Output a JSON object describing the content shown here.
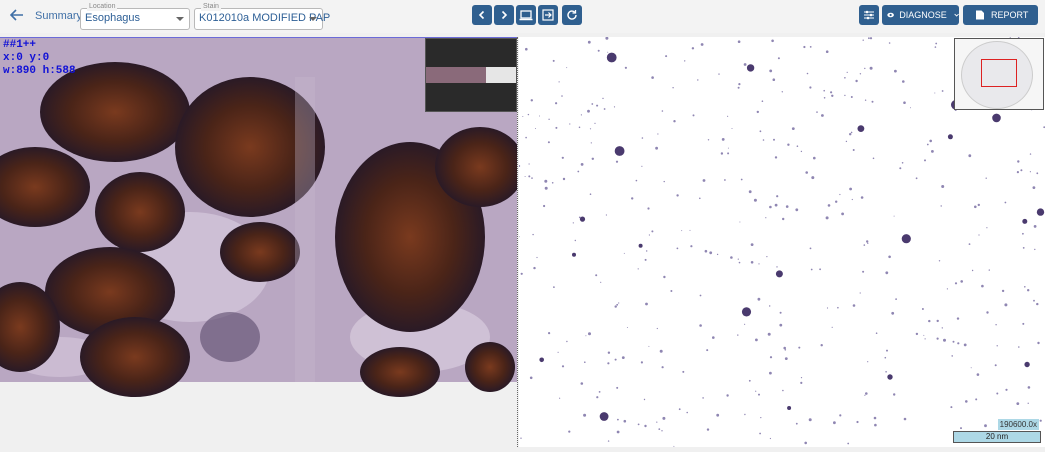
{
  "toolbar": {
    "back_icon": "arrow-left-icon",
    "summary_label": "Summary",
    "location": {
      "label": "Location",
      "value": "Esophagus"
    },
    "stain": {
      "label": "Stain",
      "value": "K012010a MODIFIED PAP"
    },
    "nav_buttons": [
      "chevron-left-icon",
      "chevron-right-icon",
      "laptop-icon",
      "exit-icon",
      "refresh-icon"
    ],
    "settings_icon": "sliders-icon",
    "diagnose_label": "DIAGNOSE",
    "report_label": "REPORT"
  },
  "left_viewer": {
    "overlay_line1": "##1++",
    "overlay_line2": "x:0 y:0",
    "overlay_line3": "w:890 h:588"
  },
  "right_viewer": {
    "zoom_label": "190600.0x",
    "scale_label": "20 nm"
  },
  "colors": {
    "accent": "#2f5f8f",
    "overlay_text": "#1212d6",
    "scale_bg": "#add8e6"
  }
}
